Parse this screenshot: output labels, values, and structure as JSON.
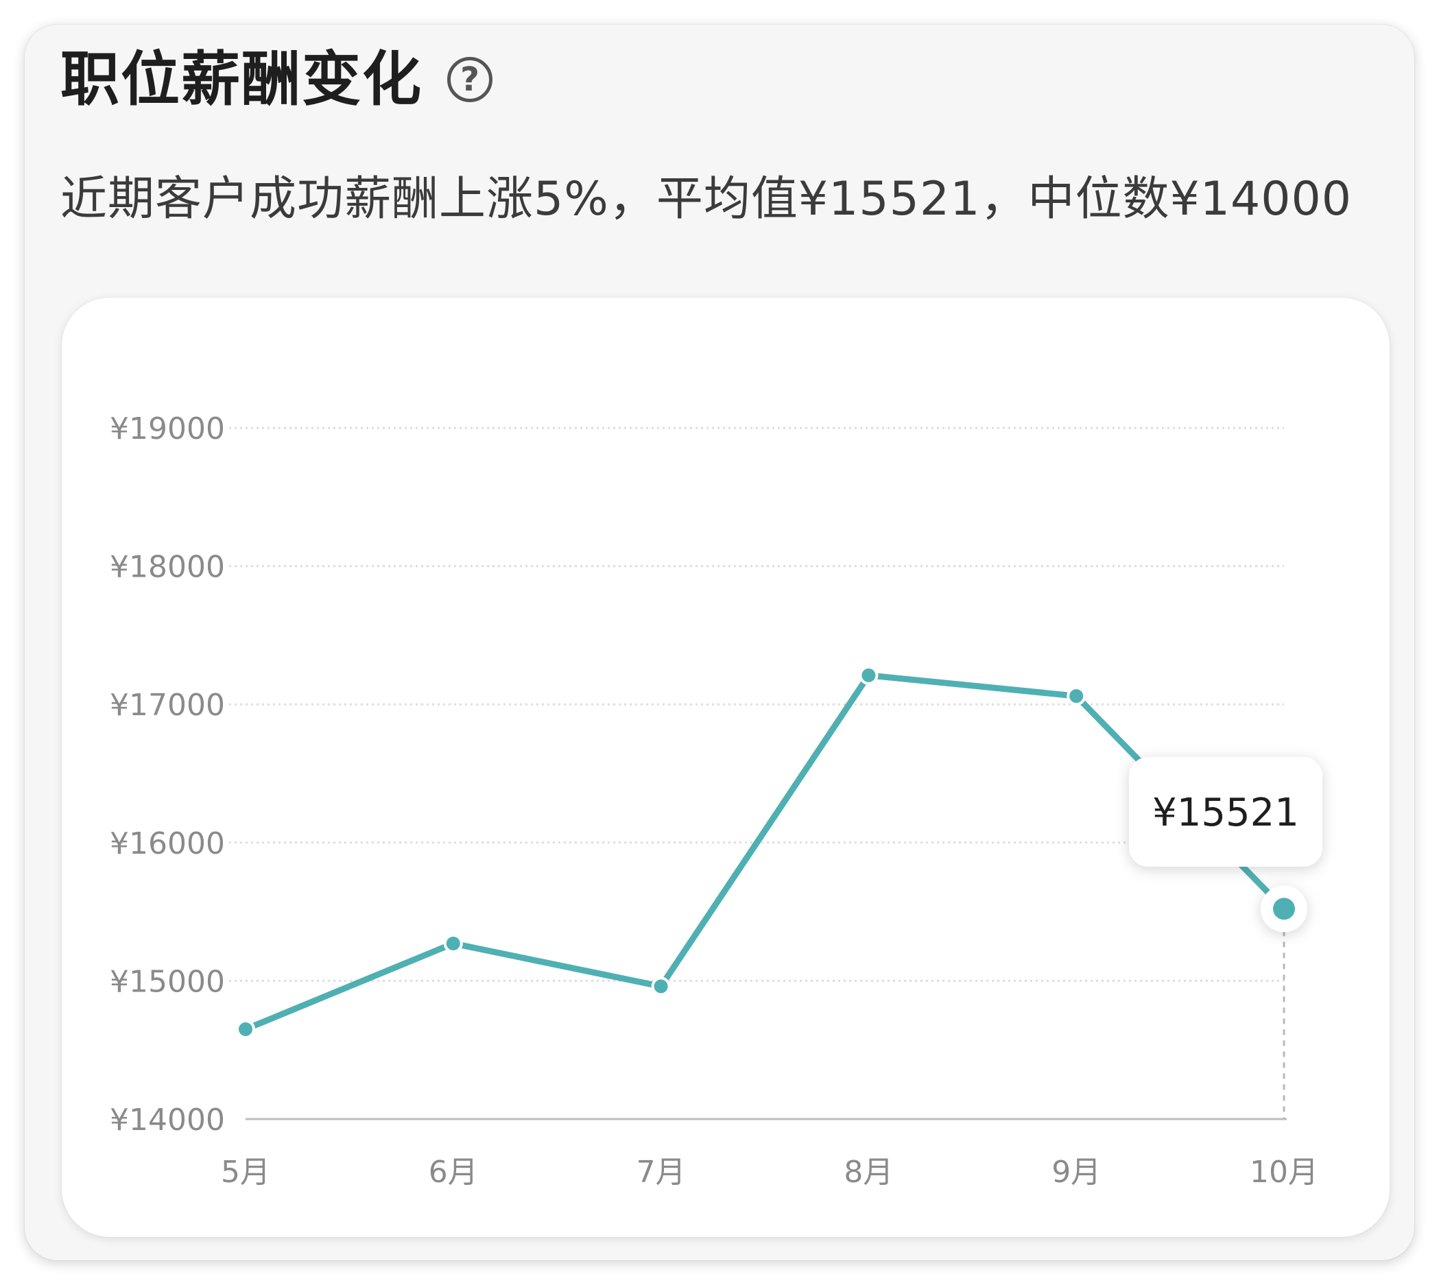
{
  "header": {
    "title": "职位薪酬变化",
    "help_icon": "?",
    "summary": "近期客户成功薪酬上涨5%，平均值¥15521，中位数¥14000"
  },
  "colors": {
    "line": "#4fb0b3",
    "grid": "#dddddd",
    "axis": "#bdbdbd",
    "tick_text": "#8a8a8a"
  },
  "chart_data": {
    "type": "line",
    "categories": [
      "5月",
      "6月",
      "7月",
      "8月",
      "9月",
      "10月"
    ],
    "series": [
      {
        "values": [
          14650,
          15270,
          14960,
          17210,
          17060,
          15521
        ]
      }
    ],
    "ylim": [
      14000,
      19000
    ],
    "yticks": [
      14000,
      15000,
      16000,
      17000,
      18000,
      19000
    ],
    "ytick_labels": [
      "¥14000",
      "¥15000",
      "¥16000",
      "¥17000",
      "¥18000",
      "¥19000"
    ],
    "grid": true,
    "tooltip": {
      "category": "10月",
      "label": "¥15521"
    }
  }
}
